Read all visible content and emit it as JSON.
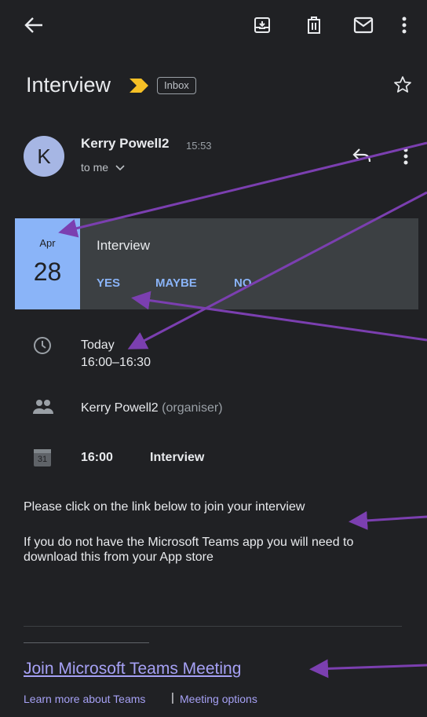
{
  "toolbar": {
    "back_icon": "arrow-left-icon",
    "archive_icon": "archive-icon",
    "delete_icon": "trash-icon",
    "mark_unread_icon": "mail-icon",
    "more_icon": "more-vert-icon"
  },
  "email": {
    "subject": "Interview",
    "label": "Inbox",
    "sender_initial": "K",
    "sender_name": "Kerry Powell2",
    "time": "15:53",
    "recipient": "to me"
  },
  "invite": {
    "month": "Apr",
    "day": "28",
    "title": "Interview",
    "rsvp_yes": "YES",
    "rsvp_maybe": "MAYBE",
    "rsvp_no": "NO"
  },
  "details": {
    "when_day": "Today",
    "when_time": "16:00–16:30",
    "organiser_name": "Kerry Powell2",
    "organiser_role": "(organiser)",
    "calendar_day": "31",
    "event_time": "16:00",
    "event_title": "Interview"
  },
  "body": {
    "line1": "Please click on the link below to join your interview",
    "line2": "If you do not have the Microsoft Teams app you will need to download this from your App store",
    "join_link": "Join Microsoft Teams Meeting",
    "learn_more": "Learn more about Teams",
    "separator": "|",
    "meeting_options": "Meeting options"
  },
  "colors": {
    "background": "#202124",
    "card": "#3c4043",
    "accent_blue": "#8ab4f8",
    "annotation_arrow": "#7b3fb0",
    "link": "#a6a1f5"
  }
}
